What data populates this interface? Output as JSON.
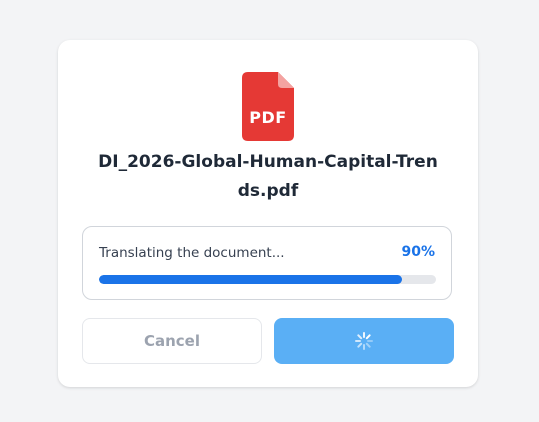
{
  "file": {
    "icon_name": "pdf-file-icon",
    "icon_label": "PDF",
    "icon_color": "#e53935",
    "name": "DI_2026-Global-Human-Capital-Trends.pdf"
  },
  "progress": {
    "status_text": "Translating the document...",
    "percent_label": "90%",
    "value": 0.9,
    "bar_color": "#1a73e8",
    "track_color": "#e5e7eb"
  },
  "actions": {
    "cancel_label": "Cancel",
    "primary_icon": "spinner-icon",
    "primary_color": "#5aaff5"
  }
}
